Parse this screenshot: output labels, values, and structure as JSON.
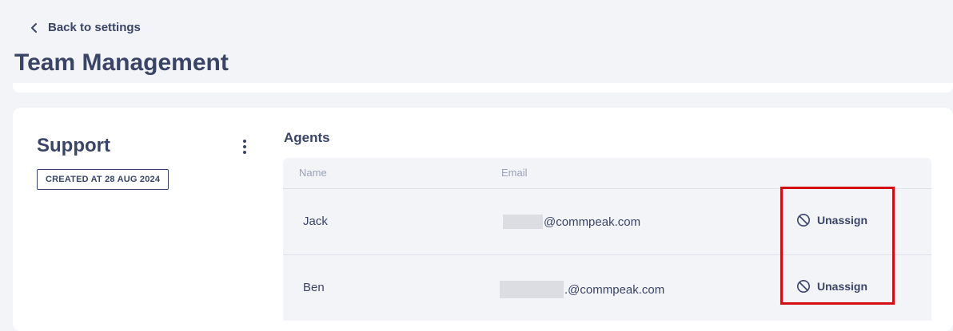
{
  "nav": {
    "back_label": "Back to settings",
    "back_icon": "chevron-left-icon"
  },
  "page": {
    "title": "Team Management"
  },
  "team": {
    "name": "Support",
    "menu_icon": "kebab-menu-icon",
    "created_badge": "CREATED AT 28 AUG 2024"
  },
  "agents": {
    "title": "Agents",
    "columns": [
      "Name",
      "Email"
    ],
    "rows": [
      {
        "name": "Jack",
        "email_suffix": "@commpeak.com",
        "action_label": "Unassign",
        "action_icon": "block-icon"
      },
      {
        "name": "Ben",
        "email_suffix": ".@commpeak.com",
        "action_label": "Unassign",
        "action_icon": "block-icon"
      }
    ]
  },
  "colors": {
    "text": "#3a4466",
    "muted": "#9aa1b8",
    "background": "#f3f4f8",
    "card": "#ffffff",
    "highlight": "#d40d12"
  }
}
